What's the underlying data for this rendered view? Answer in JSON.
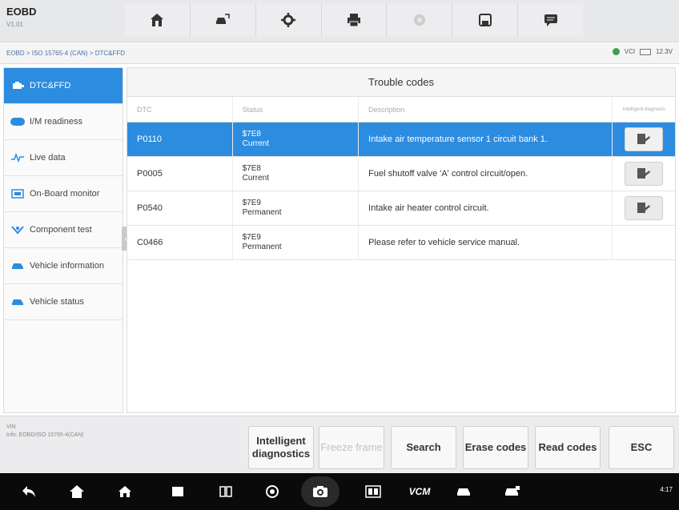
{
  "app": {
    "title": "EOBD",
    "version": "V1.01"
  },
  "toolbar": {
    "items": [
      {
        "name": "home-icon"
      },
      {
        "name": "vehicle-swap-icon"
      },
      {
        "name": "gear-icon"
      },
      {
        "name": "print-icon"
      },
      {
        "name": "record-icon"
      },
      {
        "name": "save-icon"
      },
      {
        "name": "message-icon"
      }
    ]
  },
  "breadcrumb": "EOBD > ISO 15765-4 (CAN) > DTC&FFD",
  "status": {
    "vci": "VCI",
    "voltage": "12.3V",
    "vci_color": "#3aa04a"
  },
  "sidebar": {
    "items": [
      {
        "label": "DTC&FFD",
        "icon": "engine-icon"
      },
      {
        "label": "I/M readiness",
        "icon": "im-badge-icon"
      },
      {
        "label": "Live data",
        "icon": "waveform-icon"
      },
      {
        "label": "On-Board monitor",
        "icon": "monitor-icon"
      },
      {
        "label": "Component test",
        "icon": "component-icon"
      },
      {
        "label": "Vehicle information",
        "icon": "car-info-icon"
      },
      {
        "label": "Vehicle status",
        "icon": "car-status-icon"
      }
    ]
  },
  "panel": {
    "title": "Trouble codes",
    "columns": {
      "dtc": "DTC",
      "status": "Status",
      "description": "Description",
      "intelligent": "Intelligent diagnosis"
    },
    "rows": [
      {
        "dtc": "P0110",
        "ecu": "$7E8",
        "state": "Current",
        "description": "Intake air temperature sensor 1 circuit bank 1.",
        "has_action": true
      },
      {
        "dtc": "P0005",
        "ecu": "$7E8",
        "state": "Current",
        "description": "Fuel shutoff valve 'A' control circuit/open.",
        "has_action": true
      },
      {
        "dtc": "P0540",
        "ecu": "$7E9",
        "state": "Permanent",
        "description": "Intake air heater control circuit.",
        "has_action": true
      },
      {
        "dtc": "C0466",
        "ecu": "$7E9",
        "state": "Permanent",
        "description": "Please refer to vehicle service manual.",
        "has_action": false
      }
    ]
  },
  "bottom": {
    "vin_label": "VIN",
    "vin_info": "Info: EOBD/ISO 15765-4(CAN)",
    "buttons": {
      "intelligent": "Intelligent diagnostics",
      "freeze": "Freeze frame",
      "search": "Search",
      "erase": "Erase codes",
      "read": "Read codes",
      "esc": "ESC"
    }
  },
  "navbar": {
    "vcm_label": "VCM",
    "sys_status": "4:17"
  },
  "colors": {
    "accent": "#2c8ce0"
  }
}
